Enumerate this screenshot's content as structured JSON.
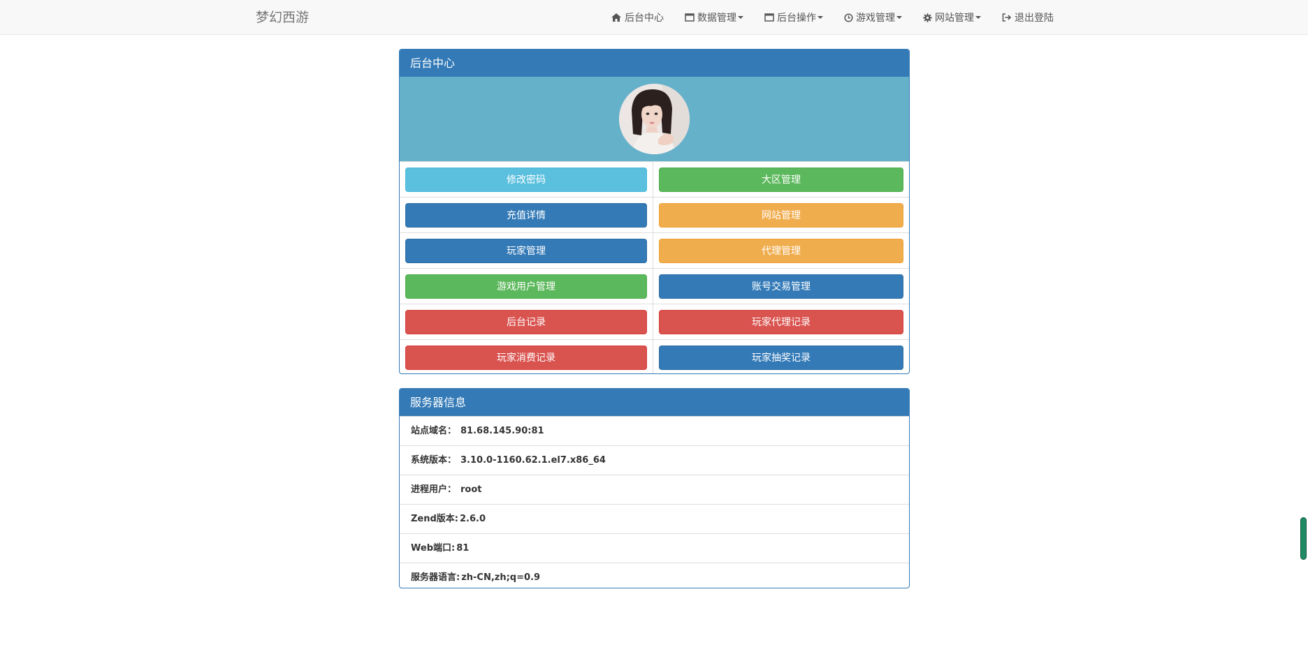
{
  "nav": {
    "brand": "梦幻西游",
    "items": [
      {
        "icon": "home-icon",
        "label": "后台中心",
        "dropdown": false
      },
      {
        "icon": "window-icon",
        "label": "数据管理",
        "dropdown": true
      },
      {
        "icon": "window-icon",
        "label": "后台操作",
        "dropdown": true
      },
      {
        "icon": "clock-icon",
        "label": "游戏管理",
        "dropdown": true
      },
      {
        "icon": "gear-icon",
        "label": "网站管理",
        "dropdown": true
      },
      {
        "icon": "logout-icon",
        "label": "退出登陆",
        "dropdown": false
      }
    ]
  },
  "admin_panel": {
    "title": "后台中心",
    "buttons": [
      {
        "label": "修改密码",
        "style": "info"
      },
      {
        "label": "大区管理",
        "style": "success"
      },
      {
        "label": "充值详情",
        "style": "primary"
      },
      {
        "label": "网站管理",
        "style": "warning"
      },
      {
        "label": "玩家管理",
        "style": "primary"
      },
      {
        "label": "代理管理",
        "style": "warning"
      },
      {
        "label": "游戏用户管理",
        "style": "success"
      },
      {
        "label": "账号交易管理",
        "style": "primary"
      },
      {
        "label": "后台记录",
        "style": "danger"
      },
      {
        "label": "玩家代理记录",
        "style": "danger"
      },
      {
        "label": "玩家消费记录",
        "style": "danger"
      },
      {
        "label": "玩家抽奖记录",
        "style": "primary"
      }
    ]
  },
  "server_panel": {
    "title": "服务器信息",
    "rows": [
      {
        "label": "站点域名：",
        "value": "81.68.145.90:81"
      },
      {
        "label": "系统版本：",
        "value": "3.10.0-1160.62.1.el7.x86_64"
      },
      {
        "label": "进程用户：",
        "value": "root"
      },
      {
        "label": "Zend版本:",
        "value": "2.6.0"
      },
      {
        "label": "Web端口:",
        "value": "81"
      },
      {
        "label": "服务器语言:",
        "value": "zh-CN,zh;q=0.9"
      }
    ]
  },
  "colors": {
    "primary": "#337ab7",
    "info": "#5bc0de",
    "success": "#5cb85c",
    "warning": "#f0ad4e",
    "danger": "#d9534f",
    "avatar_bg": "#66b1ca"
  }
}
